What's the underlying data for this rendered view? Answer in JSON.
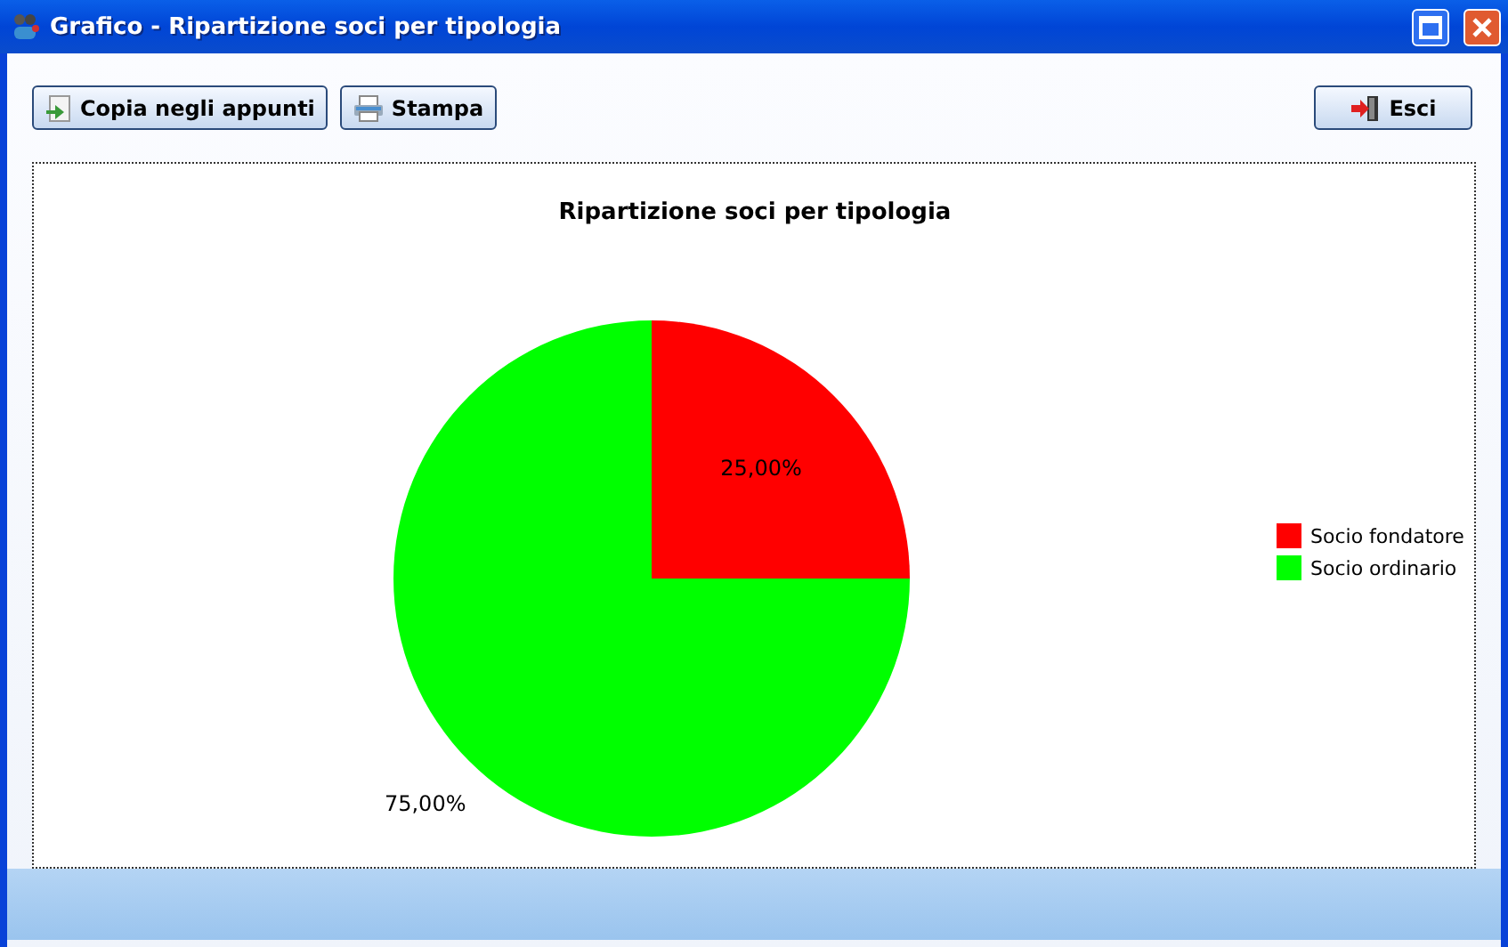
{
  "window": {
    "title": "Grafico - Ripartizione soci per tipologia"
  },
  "toolbar": {
    "buttons": [
      {
        "label": "Copia negli appunti",
        "kind": "copy"
      },
      {
        "label": "Stampa",
        "kind": "print"
      }
    ],
    "exit_button": {
      "label": "Esci",
      "kind": "exit"
    }
  },
  "chart": {
    "chart_data": {
      "type": "pie",
      "title": "Ripartizione soci per tipologia",
      "categories": [
        "Socio fondatore",
        "Socio ordinario"
      ],
      "values": [
        25,
        75
      ],
      "legend": "right",
      "colors": [
        "#ff0000",
        "#00ff00"
      ],
      "value_labels": [
        "25,00%",
        "75,00%"
      ]
    }
  }
}
